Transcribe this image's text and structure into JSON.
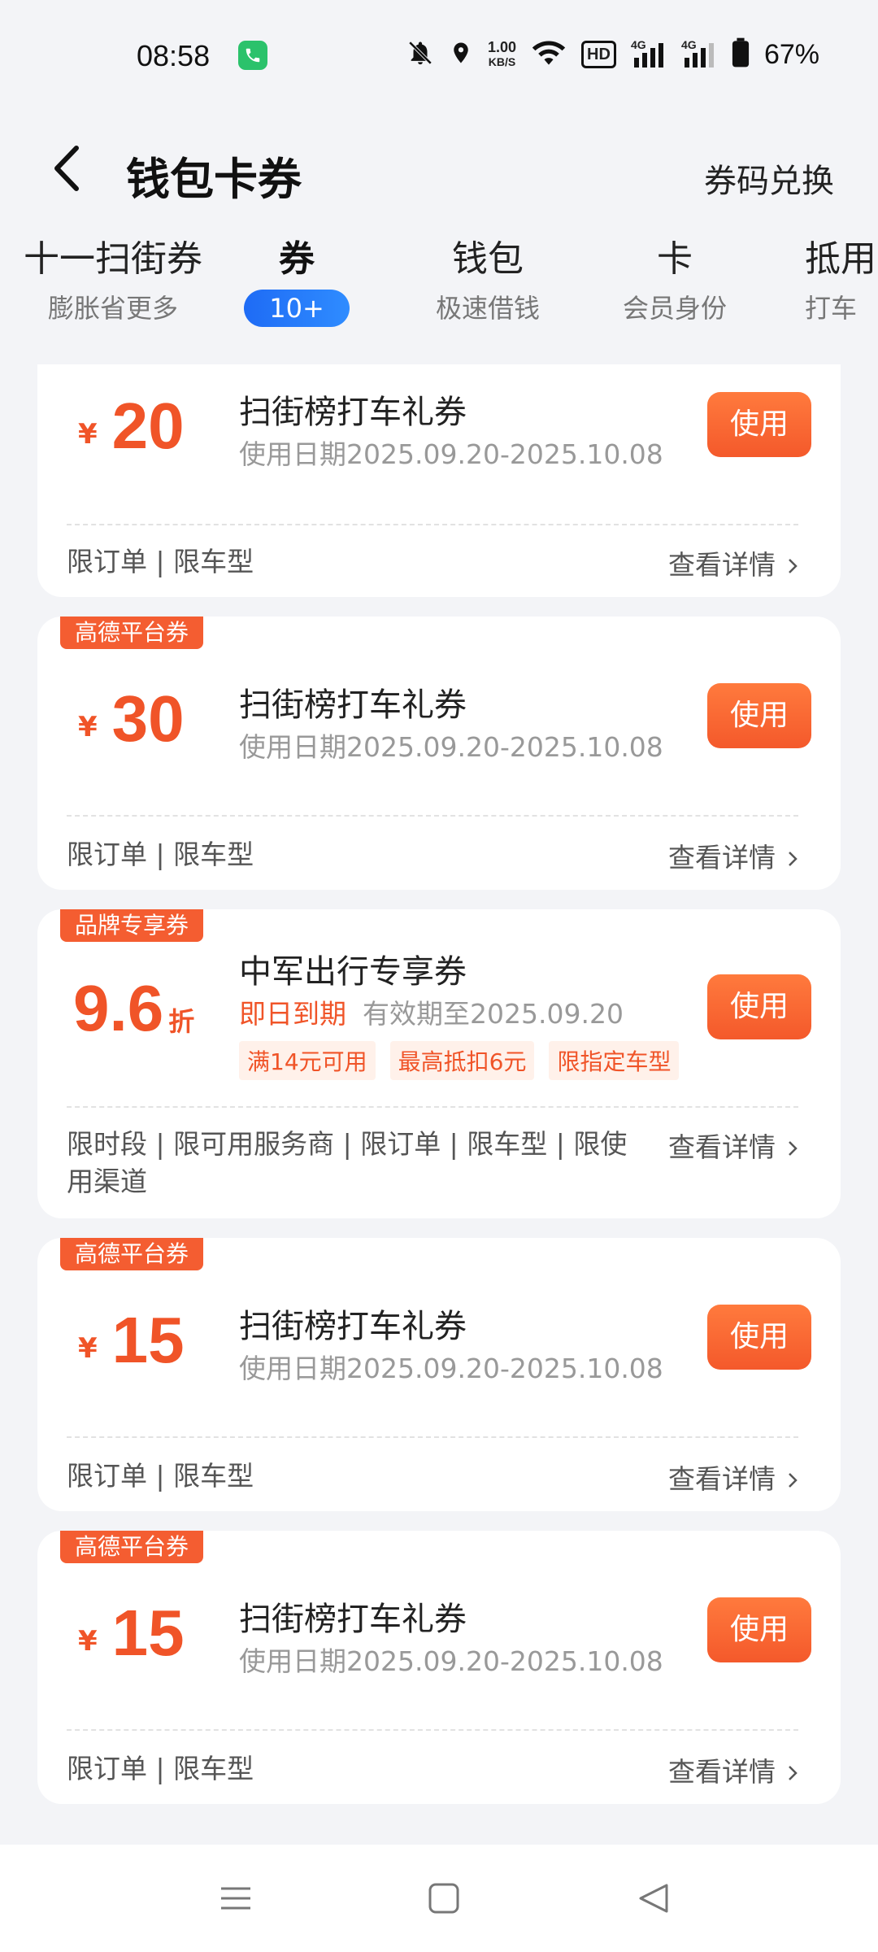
{
  "status_bar": {
    "time": "08:58",
    "net_speed_value": "1.00",
    "net_speed_unit": "KB/S",
    "hd_label": "HD",
    "signal_1_label": "4G",
    "signal_2_label": "4G",
    "battery": "67%",
    "icons": [
      "phone-icon",
      "mute-bell-icon",
      "location-icon",
      "wifi-icon",
      "signal-icon",
      "battery-icon"
    ]
  },
  "header": {
    "title": "钱包卡券",
    "action": "券码兑换"
  },
  "tabs": [
    {
      "title": "十一扫街券",
      "sub": "膨胀省更多"
    },
    {
      "title": "券",
      "badge": "10+",
      "active": true
    },
    {
      "title": "钱包",
      "sub": "极速借钱"
    },
    {
      "title": "卡",
      "sub": "会员身份"
    },
    {
      "title": "抵用",
      "sub": "打车"
    }
  ],
  "coupons": [
    {
      "tag": "",
      "currency": "¥",
      "amount": "20",
      "name": "扫街榜打车礼券",
      "date": "使用日期2025.09.20-2025.10.08",
      "use": "使用",
      "limits": "限订单 | 限车型",
      "details": "查看详情"
    },
    {
      "tag": "高德平台券",
      "currency": "¥",
      "amount": "30",
      "name": "扫街榜打车礼券",
      "date": "使用日期2025.09.20-2025.10.08",
      "use": "使用",
      "limits": "限订单 | 限车型",
      "details": "查看详情"
    },
    {
      "tag": "品牌专享券",
      "amount": "9.6",
      "unit": "折",
      "name": "中军出行专享券",
      "expire_red": "即日到期",
      "date": "有效期至2025.09.20",
      "chips": [
        "满14元可用",
        "最高抵扣6元",
        "限指定车型"
      ],
      "use": "使用",
      "limits": "限时段 | 限可用服务商 | 限订单 | 限车型 | 限使用渠道",
      "details": "查看详情"
    },
    {
      "tag": "高德平台券",
      "currency": "¥",
      "amount": "15",
      "name": "扫街榜打车礼券",
      "date": "使用日期2025.09.20-2025.10.08",
      "use": "使用",
      "limits": "限订单 | 限车型",
      "details": "查看详情"
    },
    {
      "tag": "高德平台券",
      "currency": "¥",
      "amount": "15",
      "name": "扫街榜打车礼券",
      "date": "使用日期2025.09.20-2025.10.08",
      "use": "使用",
      "limits": "限订单 | 限车型",
      "details": "查看详情"
    }
  ],
  "colors": {
    "accent": "#f05428",
    "tag_bg": "#f45d31",
    "badge_blue": "#1e6bf5",
    "page_bg": "#f3f4f7"
  }
}
